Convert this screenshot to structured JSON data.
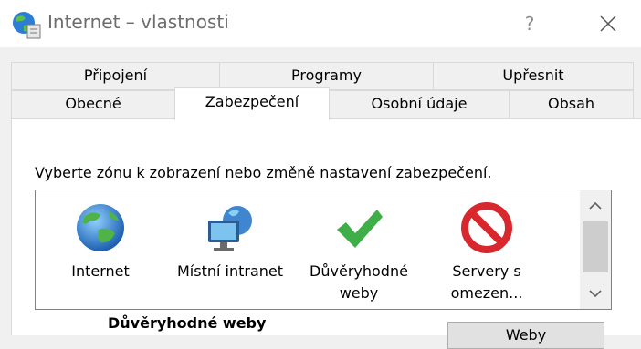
{
  "window": {
    "title": "Internet – vlastnosti",
    "help_label": "?"
  },
  "tabs": {
    "row1": [
      "Připojení",
      "Programy",
      "Upřesnit"
    ],
    "row2": [
      "Obecné",
      "Zabezpečení",
      "Osobní údaje",
      "Obsah"
    ],
    "active": "Zabezpečení"
  },
  "security": {
    "instruction": "Vyberte zónu k zobrazení nebo změně nastavení zabezpečení.",
    "zones": [
      {
        "label": "Internet",
        "icon": "globe-icon"
      },
      {
        "label": "Místní intranet",
        "icon": "intranet-icon"
      },
      {
        "label": "Důvěryhodné weby",
        "icon": "checkmark-icon",
        "selected": true
      },
      {
        "label": "Servery s omezen...",
        "icon": "restricted-icon"
      }
    ],
    "selected_zone_title": "Důvěryhodné weby",
    "sites_button": "Weby"
  },
  "colors": {
    "check_green": "#3fae49",
    "restricted_red": "#d9272e",
    "globe_blue": "#2a7fd4"
  }
}
